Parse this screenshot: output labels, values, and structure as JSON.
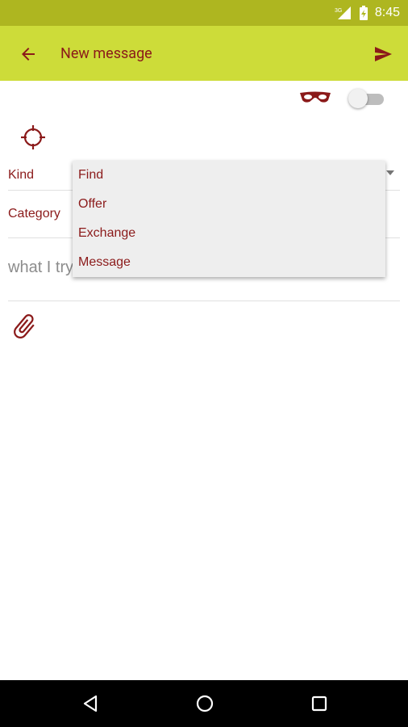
{
  "status_bar": {
    "network": "3G",
    "time": "8:45"
  },
  "app_bar": {
    "title": "New message"
  },
  "form": {
    "kind_label": "Kind",
    "category_label": "Category",
    "text_placeholder": "what I try"
  },
  "dropdown": {
    "items": [
      "Find",
      "Offer",
      "Exchange",
      "Message"
    ]
  },
  "colors": {
    "primary": "#cddc39",
    "primary_dark": "#aeb620",
    "accent": "#8b1a1a"
  },
  "icons": [
    "back-arrow-icon",
    "send-icon",
    "mask-icon",
    "toggle-switch",
    "location-target-icon",
    "paperclip-icon",
    "nav-back-icon",
    "nav-home-icon",
    "nav-recents-icon"
  ]
}
